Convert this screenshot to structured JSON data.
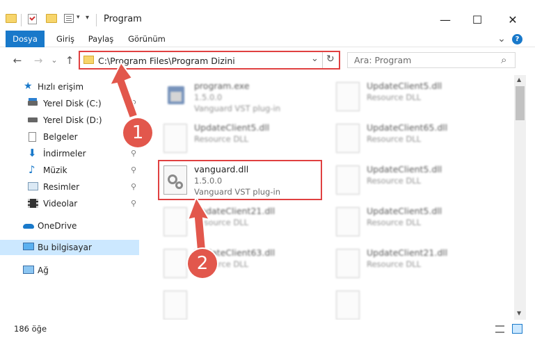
{
  "window": {
    "title": "Program",
    "minimize": "—",
    "maximize": "☐",
    "close": "✕"
  },
  "ribbon": {
    "tabs": [
      "Dosya",
      "Giriş",
      "Paylaş",
      "Görünüm"
    ],
    "active_tab": "Dosya",
    "accent_color": "#1979ca",
    "collapse_icon": "⌄",
    "help_icon": "?"
  },
  "address": {
    "path": "C:\\Program Files\\Program Dizini",
    "dropdown_icon": "⌄",
    "refresh_icon": "↻"
  },
  "search": {
    "placeholder": "Ara: Program",
    "icon": "⌕"
  },
  "nav": {
    "back": "←",
    "forward": "→",
    "recent": "⌄",
    "up": "↑"
  },
  "sidebar": {
    "items": [
      {
        "label": "Hızlı erişim",
        "pinned": false
      },
      {
        "label": "Yerel Disk (C:)",
        "pinned": true
      },
      {
        "label": "Yerel Disk (D:)",
        "pinned": false
      },
      {
        "label": "Belgeler",
        "pinned": true
      },
      {
        "label": "İndirmeler",
        "pinned": true
      },
      {
        "label": "Müzik",
        "pinned": true
      },
      {
        "label": "Resimler",
        "pinned": true
      },
      {
        "label": "Videolar",
        "pinned": true
      },
      {
        "label": "OneDrive",
        "pinned": false
      },
      {
        "label": "Bu bilgisayar",
        "pinned": false
      },
      {
        "label": "Ağ",
        "pinned": false
      }
    ],
    "selected": "Bu bilgisayar",
    "pin_icon": "📌"
  },
  "files": {
    "left": [
      {
        "name": "program.exe",
        "version": "1.5.0.0",
        "desc": "Vanguard VST plug-in"
      },
      {
        "name": "UpdateClient5.dll",
        "version": "",
        "desc": "Resource DLL"
      },
      {
        "name": "vanguard.dll",
        "version": "1.5.0.0",
        "desc": "Vanguard VST plug-in"
      },
      {
        "name": "UpdateClient21.dll",
        "version": "",
        "desc": "Resource DLL"
      },
      {
        "name": "UpdateClient63.dll",
        "version": "",
        "desc": "Resource DLL"
      }
    ],
    "right": [
      {
        "name": "UpdateClient5.dll",
        "version": "",
        "desc": "Resource DLL"
      },
      {
        "name": "UpdateClient65.dll",
        "version": "",
        "desc": "Resource DLL"
      },
      {
        "name": "UpdateClient5.dll",
        "version": "",
        "desc": "Resource DLL"
      },
      {
        "name": "UpdateClient5.dll",
        "version": "",
        "desc": "Resource DLL"
      },
      {
        "name": "UpdateClient21.dll",
        "version": "",
        "desc": "Resource DLL"
      }
    ]
  },
  "status": {
    "count": "186 öğe"
  },
  "markers": [
    "1",
    "2"
  ],
  "highlight_color": "#e04040",
  "marker_color": "#e2574c"
}
